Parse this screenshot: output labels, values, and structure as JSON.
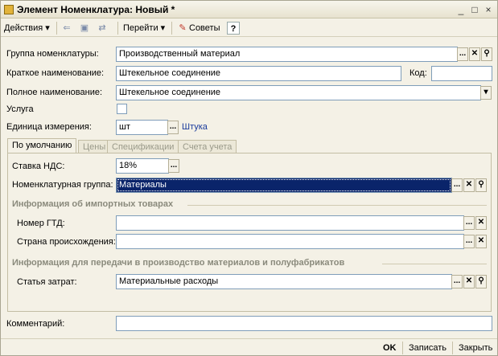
{
  "window": {
    "title": "Элемент Номенклатура: Новый *",
    "minimize": "_",
    "maximize": "□",
    "close": "×"
  },
  "toolbar": {
    "actions": "Действия ▾",
    "go": "Перейти ▾",
    "tips": "Советы",
    "help": "?"
  },
  "form": {
    "group_label": "Группа номенклатуры:",
    "group_value": "Производственный материал",
    "short_name_label": "Краткое наименование:",
    "short_name_value": "Штекельное соединение",
    "code_label": "Код:",
    "code_value": "",
    "full_name_label": "Полное наименование:",
    "full_name_value": "Штекельное соединение",
    "service_label": "Услуга",
    "unit_label": "Единица измерения:",
    "unit_value": "шт",
    "unit_link": "Штука"
  },
  "tabs": [
    {
      "label": "По умолчанию"
    },
    {
      "label": "Цены"
    },
    {
      "label": "Спецификации"
    },
    {
      "label": "Счета учета"
    }
  ],
  "tab_default": {
    "vat_label": "Ставка НДС:",
    "vat_value": "18%",
    "nom_group_label": "Номенклатурная группа:",
    "nom_group_value": "Материалы",
    "import_section": "Информация об импортных товарах",
    "gtd_label": "Номер ГТД:",
    "gtd_value": "",
    "country_label": "Страна происхождения:",
    "country_value": "",
    "production_section": "Информация для передачи в производство материалов и полуфабрикатов",
    "cost_item_label": "Статья затрат:",
    "cost_item_value": "Материальные расходы"
  },
  "comment": {
    "label": "Комментарий:",
    "value": ""
  },
  "footer": {
    "ok": "OK",
    "save": "Записать",
    "close": "Закрыть"
  },
  "glyphs": {
    "ellipsis": "...",
    "clear": "✕",
    "search": "⚲",
    "dropdown": "▾"
  }
}
